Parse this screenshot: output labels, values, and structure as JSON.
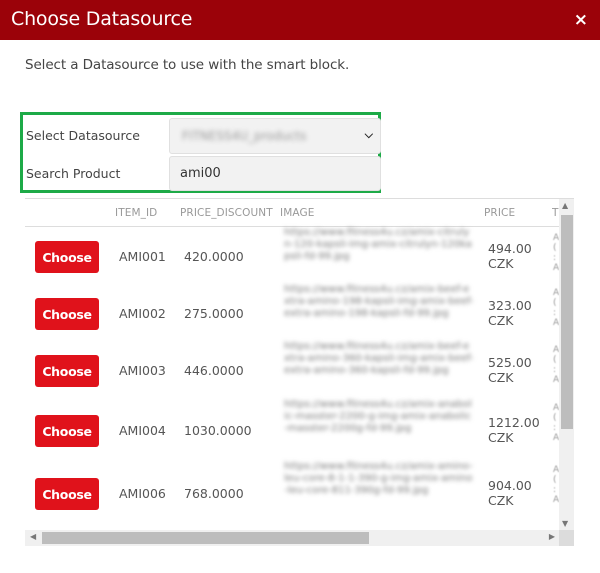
{
  "dialog": {
    "title": "Choose Datasource",
    "close_icon": "×",
    "intro": "Select a Datasource to use with the smart block."
  },
  "form": {
    "datasource_label": "Select Datasource",
    "datasource_value": "FITNESS4U_products",
    "datasource_chevron": "⌄",
    "search_label": "Search Product",
    "search_value": "ami00"
  },
  "table": {
    "columns": [
      "",
      "ITEM_ID",
      "PRICE_DISCOUNT",
      "IMAGE",
      "PRICE",
      "T"
    ],
    "choose_label": "Choose",
    "rows": [
      {
        "item_id": "AMI001",
        "price_discount": "420.0000",
        "image": "https://www.fitness4u.cz/amix-citrulyn-120-kapsli-img-amix-citrulyn-120kapsli-fd-99.jpg",
        "price": "494.00",
        "currency": "CZK"
      },
      {
        "item_id": "AMI002",
        "price_discount": "275.0000",
        "image": "https://www.fitness4u.cz/amix-beef-extra-amino-198-kapsli-img-amix-beef-extra-amino-198-kapsli-fd-99.jpg",
        "price": "323.00",
        "currency": "CZK"
      },
      {
        "item_id": "AMI003",
        "price_discount": "446.0000",
        "image": "https://www.fitness4u.cz/amix-beef-extra-amino-360-kapsli-img-amix-beef-extra-amino-360-kapsli-fd-99.jpg",
        "price": "525.00",
        "currency": "CZK"
      },
      {
        "item_id": "AMI004",
        "price_discount": "1030.0000",
        "image": "https://www.fitness4u.cz/amix-anabolic-masster-2200-g-img-amix-anabolic-masster-2200g-fd-99.jpg",
        "price": "1212.00",
        "currency": "CZK"
      },
      {
        "item_id": "AMI006",
        "price_discount": "768.0000",
        "image": "https://www.fitness4u.cz/amix-amino-leu-core-8-1-1-390-g-img-amix-amino-leu-core-811-390g-fd-99.jpg",
        "price": "904.00",
        "currency": "CZK"
      }
    ]
  },
  "scrollbars": {
    "up_arrow": "▲",
    "down_arrow": "▼",
    "left_arrow": "◀",
    "right_arrow": "▶"
  },
  "colors": {
    "header": "#9b0209",
    "choose_button": "#e0121b",
    "highlight_border": "#1daa47"
  }
}
